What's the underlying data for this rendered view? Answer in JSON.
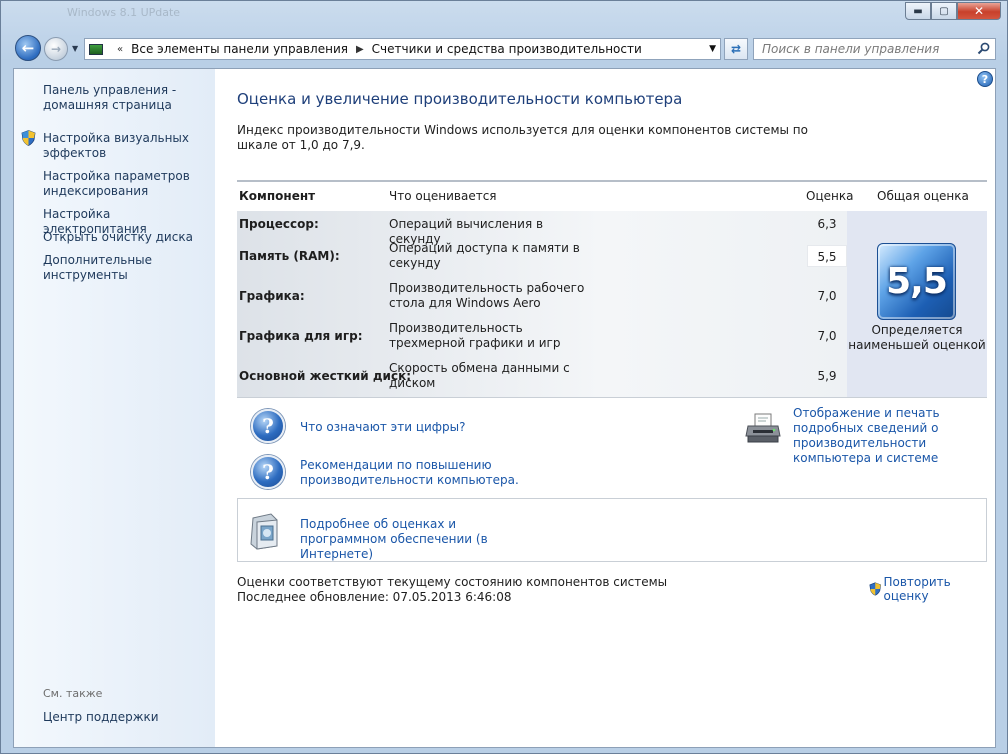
{
  "window": {
    "ghost_title": "Windows 8.1 UPdate",
    "buttons": {
      "minimize": "▬",
      "maximize": "▢",
      "close": "✕"
    }
  },
  "nav": {
    "back_icon": "back-arrow-icon",
    "forward_icon": "forward-arrow-icon",
    "breadcrumb": [
      "Все элементы панели управления",
      "Счетчики и средства производительности"
    ],
    "refresh_icon": "refresh-icon",
    "search_placeholder": "Поиск в панели управления"
  },
  "sidebar": {
    "home": "Панель управления - домашняя страница",
    "items": [
      {
        "label": "Настройка визуальных эффектов",
        "icon": "shield-icon"
      },
      {
        "label": "Настройка параметров индексирования"
      },
      {
        "label": "Настройка электропитания"
      },
      {
        "label": "Открыть очистку диска"
      },
      {
        "label": "Дополнительные инструменты"
      }
    ],
    "see_also": "См. также",
    "support": "Центр поддержки"
  },
  "main": {
    "title": "Оценка и увеличение производительности компьютера",
    "description": "Индекс производительности Windows используется для оценки компонентов системы по шкале от 1,0 до 7,9.",
    "table": {
      "headers": {
        "component": "Компонент",
        "what": "Что оценивается",
        "score": "Оценка",
        "overall": "Общая оценка"
      },
      "rows": [
        {
          "component": "Процессор:",
          "what": "Операций вычисления в секунду",
          "score": "6,3"
        },
        {
          "component": "Память (RAM):",
          "what": "Операций доступа к памяти в секунду",
          "score": "5,5"
        },
        {
          "component": "Графика:",
          "what": "Производительность рабочего стола для Windows Aero",
          "score": "7,0"
        },
        {
          "component": "Графика для игр:",
          "what": "Производительность трехмерной графики и игр",
          "score": "7,0"
        },
        {
          "component": "Основной жесткий диск:",
          "what": "Скорость обмена данными с диском",
          "score": "5,9"
        }
      ],
      "overall_score": "5,5",
      "overall_caption": "Определяется наименьшей оценкой"
    },
    "links": {
      "what_numbers": "Что означают эти цифры?",
      "tips": "Рекомендации по повышению производительности компьютера.",
      "print": "Отображение и печать подробных сведений о производительности компьютера и системе",
      "online": "Подробнее об оценках и программном обеспечении (в Интернете)"
    },
    "status_line1": "Оценки соответствуют текущему состоянию компонентов системы",
    "status_line2": "Последнее обновление: 07.05.2013 6:46:08",
    "rerun": "Повторить оценку"
  },
  "colors": {
    "link": "#1a56a8",
    "title": "#1e3f7a",
    "badge": "#1d5fb4"
  }
}
